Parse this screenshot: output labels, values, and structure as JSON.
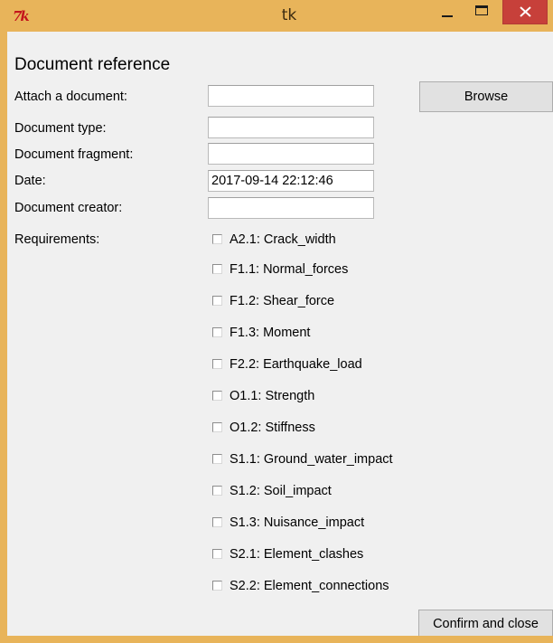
{
  "window": {
    "title": "tk",
    "icon": "tk-feather-icon",
    "controls": [
      "minimize-icon",
      "maximize-icon",
      "close-icon"
    ],
    "frame_color": "#e8b45a",
    "close_color": "#c7403a"
  },
  "form": {
    "heading": "Document reference",
    "attach_label": "Attach a document:",
    "attach_value": "",
    "browse_label": "Browse",
    "type_label": "Document type:",
    "type_value": "",
    "fragment_label": "Document fragment:",
    "fragment_value": "",
    "date_label": "Date:",
    "date_value": "2017-09-14 22:12:46",
    "creator_label": "Document creator:",
    "creator_value": "",
    "requirements_label": "Requirements:",
    "requirements": [
      {
        "label": "A2.1: Crack_width",
        "checked": false
      },
      {
        "label": "F1.1: Normal_forces",
        "checked": false
      },
      {
        "label": "F1.2: Shear_force",
        "checked": false
      },
      {
        "label": "F1.3: Moment",
        "checked": false
      },
      {
        "label": "F2.2: Earthquake_load",
        "checked": false
      },
      {
        "label": "O1.1: Strength",
        "checked": false
      },
      {
        "label": "O1.2: Stiffness",
        "checked": false
      },
      {
        "label": "S1.1: Ground_water_impact",
        "checked": false
      },
      {
        "label": "S1.2: Soil_impact",
        "checked": false
      },
      {
        "label": "S1.3: Nuisance_impact",
        "checked": false
      },
      {
        "label": "S2.1: Element_clashes",
        "checked": false
      },
      {
        "label": "S2.2: Element_connections",
        "checked": false
      }
    ],
    "confirm_label": "Confirm and close"
  }
}
